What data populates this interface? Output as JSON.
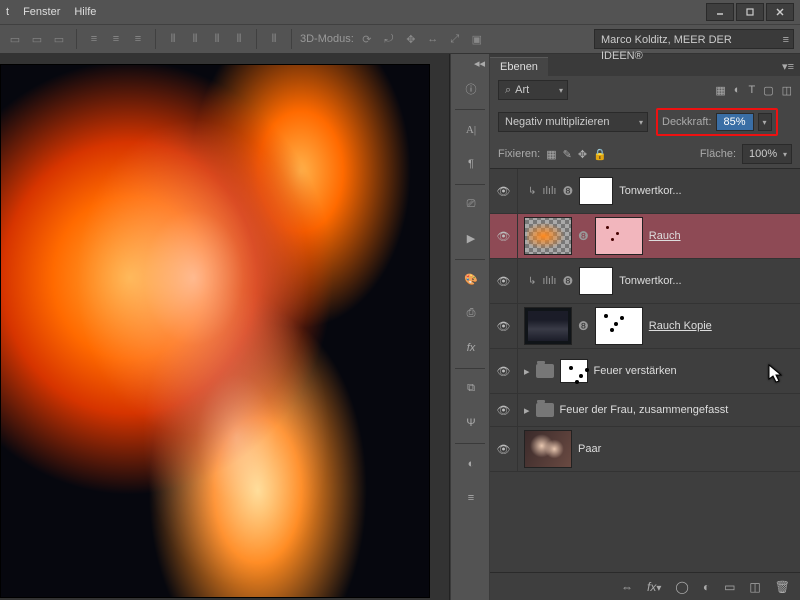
{
  "menu": {
    "item0": "t",
    "item1": "Fenster",
    "item2": "Hilfe"
  },
  "optionsbar": {
    "mode3d_label": "3D-Modus:"
  },
  "user_dropdown": "Marco Kolditz, MEER DER IDEEN®",
  "panel": {
    "tab": "Ebenen",
    "filter_kind": "Art",
    "blend_mode": "Negativ multiplizieren",
    "opacity_label": "Deckkraft:",
    "opacity_value": "85%",
    "fill_label": "Fläche:",
    "fill_value": "100%",
    "lock_label": "Fixieren:"
  },
  "layers": [
    {
      "name": "Tonwertkor...",
      "type": "adjustment",
      "clipped": true
    },
    {
      "name": "Rauch",
      "type": "smart",
      "selected": true,
      "underline": true
    },
    {
      "name": "Tonwertkor...",
      "type": "adjustment",
      "clipped": true
    },
    {
      "name": "Rauch Kopie",
      "type": "smart",
      "underline": true
    },
    {
      "name": "Feuer verstärken",
      "type": "group"
    },
    {
      "name": "Feuer der Frau, zusammengefasst",
      "type": "group"
    },
    {
      "name": "Paar",
      "type": "pixel"
    }
  ]
}
